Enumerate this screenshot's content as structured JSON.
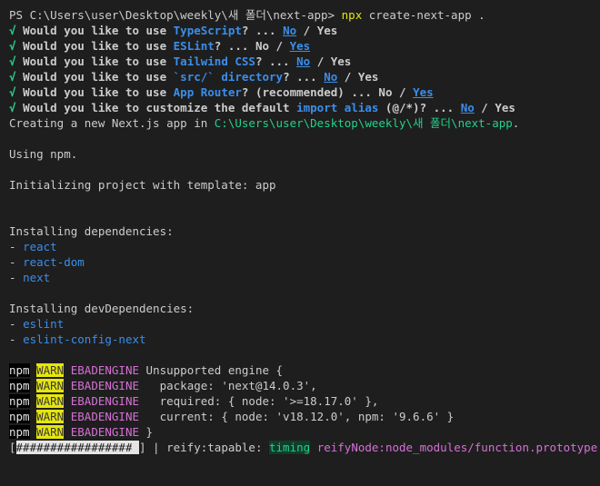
{
  "prompt_line": {
    "prompt": "PS C:\\Users\\user\\Desktop\\weekly\\새 폴더\\next-app>",
    "cmd": "npx",
    "args": "create-next-app ."
  },
  "questions": [
    {
      "check": "√",
      "pre": "Would you like to use ",
      "term": "TypeScript",
      "post": "? ... ",
      "opt1": "No",
      "sep": " / ",
      "opt2": "Yes",
      "selected": "No"
    },
    {
      "check": "√",
      "pre": "Would you like to use ",
      "term": "ESLint",
      "post": "? ... ",
      "opt1": "No",
      "sep": " / ",
      "opt2": "Yes",
      "selected": "Yes"
    },
    {
      "check": "√",
      "pre": "Would you like to use ",
      "term": "Tailwind CSS",
      "post": "? ... ",
      "opt1": "No",
      "sep": " / ",
      "opt2": "Yes",
      "selected": "No"
    },
    {
      "check": "√",
      "pre": "Would you like to use ",
      "term": "`src/` directory",
      "post": "? ... ",
      "opt1": "No",
      "sep": " / ",
      "opt2": "Yes",
      "selected": "No"
    },
    {
      "check": "√",
      "pre": "Would you like to use ",
      "term": "App Router",
      "post": "? (recommended) ... ",
      "opt1": "No",
      "sep": " / ",
      "opt2": "Yes",
      "selected": "Yes"
    }
  ],
  "alias_question": {
    "check": "√",
    "pre": "Would you like to customize the default ",
    "term": "import alias",
    "mid": " (@/*)",
    "post": "? ... ",
    "opt1": "No",
    "sep": " / ",
    "opt2": "Yes",
    "selected": "No"
  },
  "creating": {
    "text": "Creating a new Next.js app in ",
    "path": "C:\\Users\\user\\Desktop\\weekly\\새 폴더\\next-app",
    "end": "."
  },
  "using_npm": "Using npm.",
  "initializing": "Initializing project with template: app",
  "deps": {
    "header": "Installing dependencies:",
    "items": [
      "react",
      "react-dom",
      "next"
    ]
  },
  "dev_deps": {
    "header": "Installing devDependencies:",
    "items": [
      "eslint",
      "eslint-config-next"
    ]
  },
  "warnings": [
    {
      "npm": "npm",
      "warn": "WARN",
      "code": "EBADENGINE",
      "msg": " Unsupported engine {"
    },
    {
      "npm": "npm",
      "warn": "WARN",
      "code": "EBADENGINE",
      "msg": "   package: 'next@14.0.3',"
    },
    {
      "npm": "npm",
      "warn": "WARN",
      "code": "EBADENGINE",
      "msg": "   required: { node: '>=18.17.0' },"
    },
    {
      "npm": "npm",
      "warn": "WARN",
      "code": "EBADENGINE",
      "msg": "   current: { node: 'v18.12.0', npm: '9.6.6' }"
    },
    {
      "npm": "npm",
      "warn": "WARN",
      "code": "EBADENGINE",
      "msg": " }"
    }
  ],
  "progress": {
    "open": "[",
    "fill": "#################",
    "cursor": " ",
    "close": "]",
    "sep": " | ",
    "stage": "reify:tapable:",
    "sp": " ",
    "timing": "timing",
    "sp2": " ",
    "detail": "reifyNode:node_modules/function.prototype.name C",
    "fraction": 0.93
  },
  "colors": {
    "background": "#1e1e1e",
    "green": "#23d18b",
    "blue": "#3b8eea",
    "yellow": "#e5e510",
    "magenta": "#d670d6"
  }
}
